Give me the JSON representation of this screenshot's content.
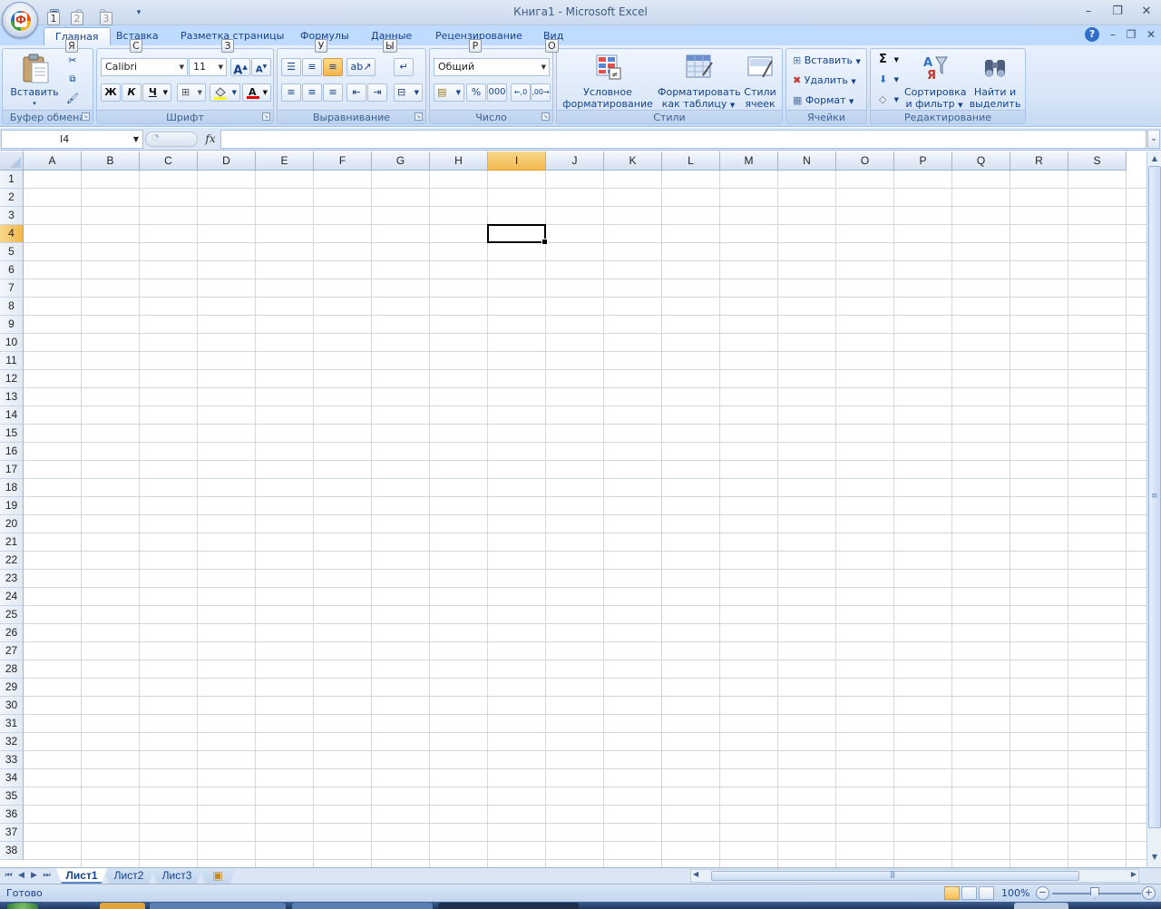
{
  "app": {
    "title": "Книга1 - Microsoft Excel"
  },
  "quick_access": {
    "keytips": [
      "1",
      "2",
      "3"
    ]
  },
  "ribbon": {
    "tabs": [
      {
        "label": "Главная",
        "keytip": "Я",
        "active": true
      },
      {
        "label": "Вставка",
        "keytip": "С"
      },
      {
        "label": "Разметка страницы",
        "keytip": "З"
      },
      {
        "label": "Формулы",
        "keytip": "У"
      },
      {
        "label": "Данные",
        "keytip": "Ы"
      },
      {
        "label": "Рецензирование",
        "keytip": "Р"
      },
      {
        "label": "Вид",
        "keytip": "О"
      }
    ],
    "groups": {
      "clipboard": {
        "label": "Буфер обмена",
        "paste": "Вставить"
      },
      "font": {
        "label": "Шрифт",
        "font_name": "Calibri",
        "font_size": "11",
        "bold": "Ж",
        "italic": "К",
        "underline": "Ч",
        "grow": "A",
        "shrink": "A",
        "font_color_letter": "A"
      },
      "alignment": {
        "label": "Выравнивание"
      },
      "number": {
        "label": "Число",
        "format": "Общий",
        "percent": "%",
        "thousands": "000"
      },
      "styles": {
        "label": "Стили",
        "conditional": [
          "Условное",
          "форматирование"
        ],
        "as_table": [
          "Форматировать",
          "как таблицу"
        ],
        "cell_styles": [
          "Стили",
          "ячеек"
        ]
      },
      "cells": {
        "label": "Ячейки",
        "insert": "Вставить",
        "delete": "Удалить",
        "format": "Формат"
      },
      "editing": {
        "label": "Редактирование",
        "sigma": "Σ",
        "sort": [
          "Сортировка",
          "и фильтр"
        ],
        "find": [
          "Найти и",
          "выделить"
        ]
      }
    }
  },
  "formula_bar": {
    "name_box": "I4",
    "fx": "fx",
    "formula": ""
  },
  "grid": {
    "columns": [
      "A",
      "B",
      "C",
      "D",
      "E",
      "F",
      "G",
      "H",
      "I",
      "J",
      "K",
      "L",
      "M",
      "N",
      "O",
      "P",
      "Q",
      "R",
      "S"
    ],
    "rows": [
      "1",
      "2",
      "3",
      "4",
      "5",
      "6",
      "7",
      "8",
      "9",
      "10",
      "11",
      "12",
      "13",
      "14",
      "15",
      "16",
      "17",
      "18",
      "19",
      "20",
      "21",
      "22",
      "23",
      "24",
      "25",
      "26",
      "27",
      "28",
      "29",
      "30",
      "31",
      "32",
      "33",
      "34",
      "35",
      "36",
      "37",
      "38"
    ],
    "selected_column": "I",
    "selected_row": "4"
  },
  "sheets": {
    "tabs": [
      "Лист1",
      "Лист2",
      "Лист3"
    ],
    "active": "Лист1"
  },
  "status": {
    "text": "Готово",
    "zoom": "100%"
  },
  "colors": {
    "ribbon_text": "#15428b",
    "selection_header": "#f2b74f",
    "gridline": "#d0d7e5"
  }
}
